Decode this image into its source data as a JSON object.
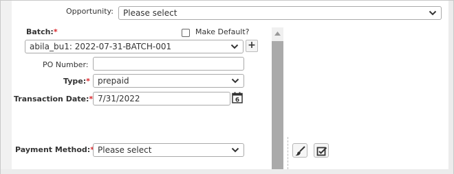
{
  "opportunity": {
    "label": "Opportunity:",
    "value": "Please select"
  },
  "batch": {
    "label": "Batch:",
    "required": "*",
    "value": "abila_bu1: 2022-07-31-BATCH-001",
    "make_default_label": "Make Default?",
    "add_label": "+"
  },
  "po_number": {
    "label": "PO Number:",
    "value": ""
  },
  "type": {
    "label": "Type:",
    "required": "*",
    "value": "prepaid"
  },
  "transaction_date": {
    "label": "Transaction Date:",
    "required": "*",
    "value": "7/31/2022",
    "calendar_day": "6"
  },
  "payment_method": {
    "label": "Payment Method:",
    "required": "*",
    "value": "Please select"
  },
  "toolbar": {
    "clear_icon": "brush-icon",
    "edit_icon": "edit-check-icon"
  }
}
